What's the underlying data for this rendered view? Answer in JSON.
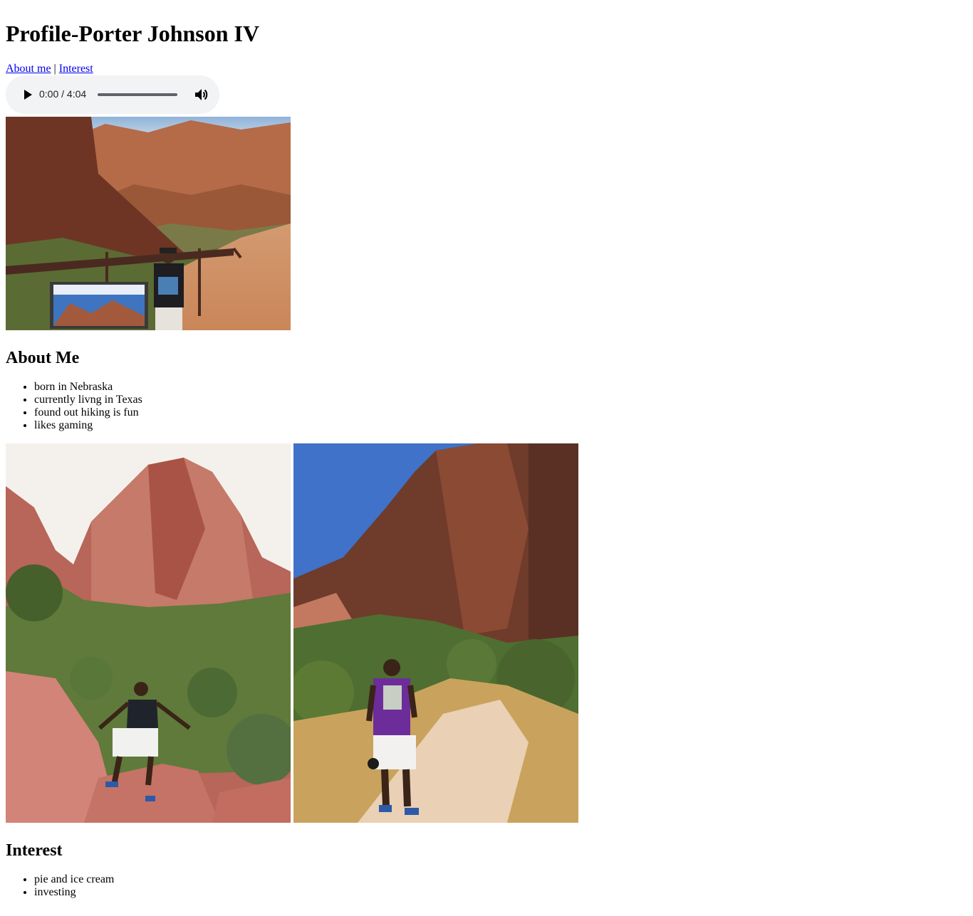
{
  "page": {
    "title": "Profile-Porter Johnson IV"
  },
  "nav": {
    "about_label": "About me",
    "separator": "|",
    "interest_label": "Interest"
  },
  "audio": {
    "time": "0:00 / 4:04",
    "progress_fraction": 0,
    "play_icon": "play-icon",
    "volume_icon": "volume-icon"
  },
  "about": {
    "heading": "About Me",
    "items": [
      "born in Nebraska",
      "currently livng in Texas",
      "found out hiking is fun",
      "likes gaming"
    ]
  },
  "interest": {
    "heading": "Interest",
    "items": [
      "pie and ice cream",
      "investing"
    ]
  },
  "colors": {
    "link": "#0000ee",
    "audio_bg": "#f1f3f4"
  }
}
